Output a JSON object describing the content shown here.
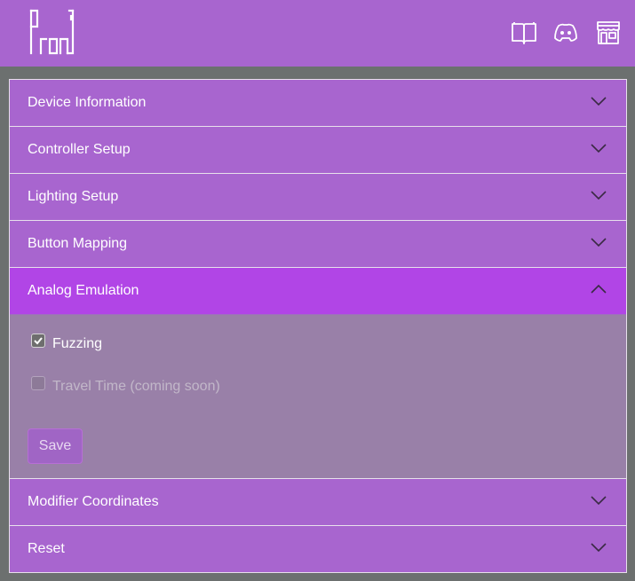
{
  "header": {
    "nav_icons": [
      {
        "name": "book-icon",
        "label": "Docs"
      },
      {
        "name": "discord-icon",
        "label": "Discord"
      },
      {
        "name": "store-icon",
        "label": "Store"
      }
    ]
  },
  "accordion": {
    "items": [
      {
        "title": "Device Information",
        "open": false
      },
      {
        "title": "Controller Setup",
        "open": false
      },
      {
        "title": "Lighting Setup",
        "open": false
      },
      {
        "title": "Button Mapping",
        "open": false
      },
      {
        "title": "Analog Emulation",
        "open": true
      },
      {
        "title": "Modifier Coordinates",
        "open": false
      },
      {
        "title": "Reset",
        "open": false
      }
    ],
    "analog": {
      "fuzzing_label": "Fuzzing",
      "fuzzing_checked": true,
      "travel_label": "Travel Time (coming soon)",
      "travel_checked": false,
      "travel_disabled": true,
      "save_label": "Save"
    }
  },
  "colors": {
    "header_bg": "#a865cf",
    "item_bg": "#a865cf",
    "active_item_bg": "#b145e6",
    "panel_bg": "#9980a8",
    "page_bg": "#6c706f"
  }
}
